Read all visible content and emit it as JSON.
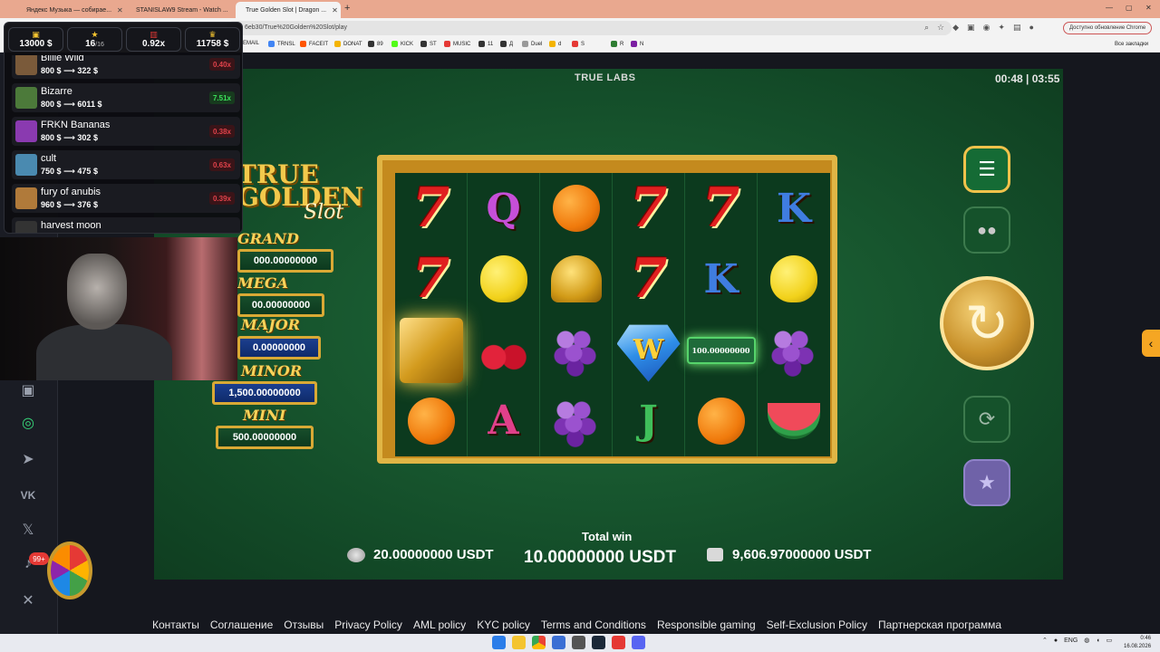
{
  "browser": {
    "tabs": [
      {
        "title": "Яндекс Музыка — собирае...",
        "color": "#e53935"
      },
      {
        "title": "STANISLAW9 Stream - Watch ...",
        "color": "#53fc18"
      },
      {
        "title": "True Golden Slot | Dragon ...",
        "color": "#f4b400"
      }
    ],
    "new_tab": "+",
    "url": "6eb30/True%20Golden%20Slot/play",
    "update_label": "Доступно обновление Chrome",
    "bookmarks": [
      "EMAIL",
      "TRNSL",
      "FACEIT",
      "DONAT",
      "89",
      "KICK",
      "ST",
      "MUSIC",
      "11",
      "Д",
      "Duel",
      "d",
      "S",
      "R",
      "N"
    ],
    "all_bookmarks": "Все закладки"
  },
  "overlay": {
    "stats": [
      {
        "value": "13000 $",
        "sub": ""
      },
      {
        "value": "16",
        "sub": "/16"
      },
      {
        "value": "0.92x",
        "sub": ""
      },
      {
        "value": "11758 $",
        "sub": ""
      }
    ],
    "bonuses": [
      {
        "name": "Billie Wild",
        "amount": "800 $ ⟶ 322 $",
        "x": "0.40x",
        "tone": "red",
        "thumb": "#7a5a3a"
      },
      {
        "name": "Bizarre",
        "amount": "800 $ ⟶ 6011 $",
        "x": "7.51x",
        "tone": "green",
        "thumb": "#4c7a3a"
      },
      {
        "name": "FRKN Bananas",
        "amount": "800 $ ⟶ 302 $",
        "x": "0.38x",
        "tone": "red",
        "thumb": "#8a3ab0"
      },
      {
        "name": "cult",
        "amount": "750 $ ⟶ 475 $",
        "x": "0.63x",
        "tone": "red",
        "thumb": "#4a8ab0"
      },
      {
        "name": "fury of anubis",
        "amount": "960 $ ⟶ 376 $",
        "x": "0.39x",
        "tone": "red",
        "thumb": "#b07a3a"
      },
      {
        "name": "harvest moon",
        "amount": "",
        "x": "",
        "tone": "red",
        "thumb": "#333333"
      }
    ]
  },
  "game": {
    "brand": "TRUE LABS",
    "timer": "00:48 | 03:55",
    "logo_line1": "TRUE",
    "logo_line2": "GOLDEN",
    "logo_slot": "Slot",
    "jackpots": [
      {
        "label": "GRAND",
        "value": "000.00000000"
      },
      {
        "label": "MEGA",
        "value": "00.00000000"
      },
      {
        "label": "MAJOR",
        "value": "0.00000000"
      },
      {
        "label": "MINOR",
        "value": "1,500.00000000"
      },
      {
        "label": "MINI",
        "value": "500.00000000"
      }
    ],
    "reel_letters": {
      "q": "Q",
      "k": "K",
      "a": "A",
      "j": "J",
      "w": "W"
    },
    "cash_value": "100.00000000",
    "total_win_label": "Total win",
    "bet": "20.00000000 USDT",
    "total_win": "10.00000000 USDT",
    "balance": "9,606.97000000 USDT"
  },
  "footer_links": [
    "Контакты",
    "Соглашение",
    "Отзывы",
    "Privacy Policy",
    "AML policy",
    "KYC policy",
    "Terms and Conditions",
    "Responsible gaming",
    "Self-Exclusion Policy",
    "Партнерская программа"
  ],
  "notifications_badge": "99+",
  "taskbar": {
    "lang": "ENG",
    "time": "0:46",
    "date": "16.08.2026"
  }
}
